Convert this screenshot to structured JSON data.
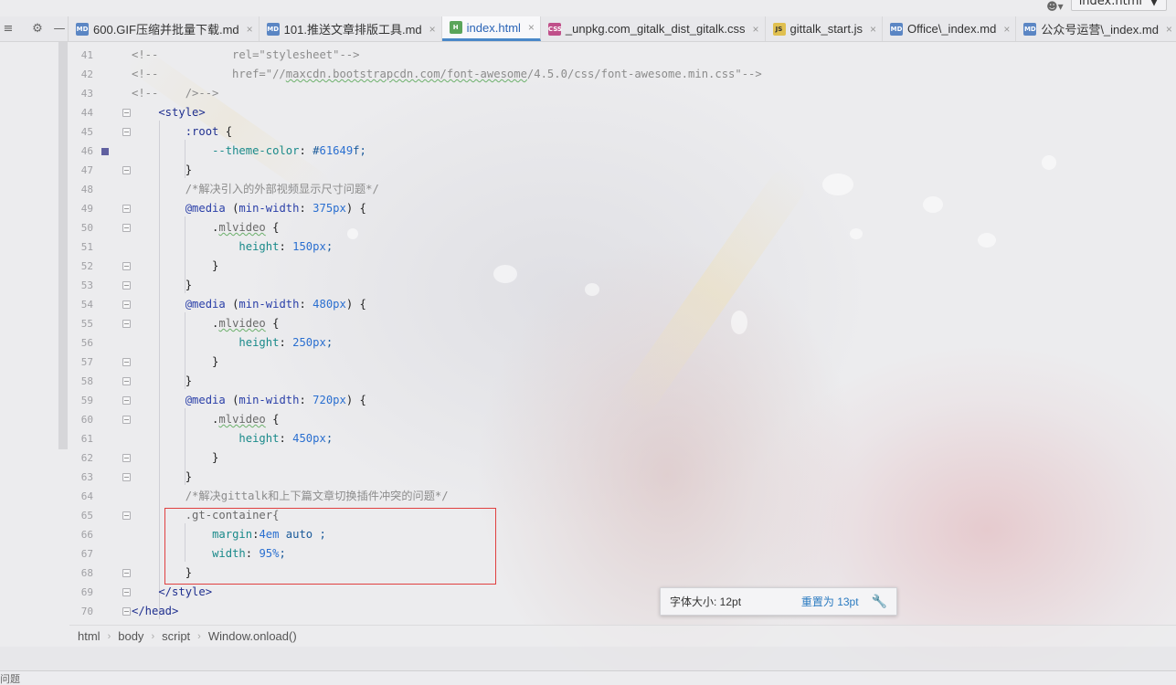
{
  "tabs": [
    {
      "icon": "MD",
      "icon_kind": "md",
      "label": "600.GIF压缩并批量下载.md",
      "active": false
    },
    {
      "icon": "MD",
      "icon_kind": "md",
      "label": "101.推送文章排版工具.md",
      "active": false
    },
    {
      "icon": "H",
      "icon_kind": "html",
      "label": "index.html",
      "active": true
    },
    {
      "icon": "CSS",
      "icon_kind": "css",
      "label": "_unpkg.com_gitalk_dist_gitalk.css",
      "active": false
    },
    {
      "icon": "JS",
      "icon_kind": "js",
      "label": "gittalk_start.js",
      "active": false
    },
    {
      "icon": "MD",
      "icon_kind": "md",
      "label": "Office\\_index.md",
      "active": false
    },
    {
      "icon": "MD",
      "icon_kind": "md",
      "label": "公众号运营\\_index.md",
      "active": false
    }
  ],
  "toolbar": {
    "run_config": "index.html",
    "user_icon": "user-icon"
  },
  "editor": {
    "lines": [
      {
        "n": "41",
        "text": "<!--           rel=\"stylesheet\"-->"
      },
      {
        "n": "42",
        "text": "<!--           href=\"//maxcdn.bootstrapcdn.com/font-awesome/4.5.0/css/font-awesome.min.css\"-->"
      },
      {
        "n": "43",
        "text": "<!--    />-->"
      },
      {
        "n": "44",
        "text": "    <style>"
      },
      {
        "n": "45",
        "text": "        :root {"
      },
      {
        "n": "46",
        "text": "            --theme-color: #61649f;"
      },
      {
        "n": "47",
        "text": "        }"
      },
      {
        "n": "48",
        "text": "        /*解决引入的外部视频显示尺寸问题*/"
      },
      {
        "n": "49",
        "text": "        @media (min-width: 375px) {"
      },
      {
        "n": "50",
        "text": "            .mlvideo {"
      },
      {
        "n": "51",
        "text": "                height: 150px;"
      },
      {
        "n": "52",
        "text": "            }"
      },
      {
        "n": "53",
        "text": "        }"
      },
      {
        "n": "54",
        "text": "        @media (min-width: 480px) {"
      },
      {
        "n": "55",
        "text": "            .mlvideo {"
      },
      {
        "n": "56",
        "text": "                height: 250px;"
      },
      {
        "n": "57",
        "text": "            }"
      },
      {
        "n": "58",
        "text": "        }"
      },
      {
        "n": "59",
        "text": "        @media (min-width: 720px) {"
      },
      {
        "n": "60",
        "text": "            .mlvideo {"
      },
      {
        "n": "61",
        "text": "                height: 450px;"
      },
      {
        "n": "62",
        "text": "            }"
      },
      {
        "n": "63",
        "text": "        }"
      },
      {
        "n": "64",
        "text": "        /*解决gittalk和上下篇文章切换插件冲突的问题*/"
      },
      {
        "n": "65",
        "text": "        .gt-container{"
      },
      {
        "n": "66",
        "text": "            margin:4em auto ;"
      },
      {
        "n": "67",
        "text": "            width: 95%;"
      },
      {
        "n": "68",
        "text": "        }"
      },
      {
        "n": "69",
        "text": "    </style>"
      },
      {
        "n": "70",
        "text": "</head>"
      }
    ]
  },
  "font_popup": {
    "label": "字体大小: 12pt",
    "reset": "重置为 13pt"
  },
  "breadcrumb": [
    "html",
    "body",
    "script",
    "Window.onload()"
  ],
  "status": {
    "problems": "问题"
  }
}
